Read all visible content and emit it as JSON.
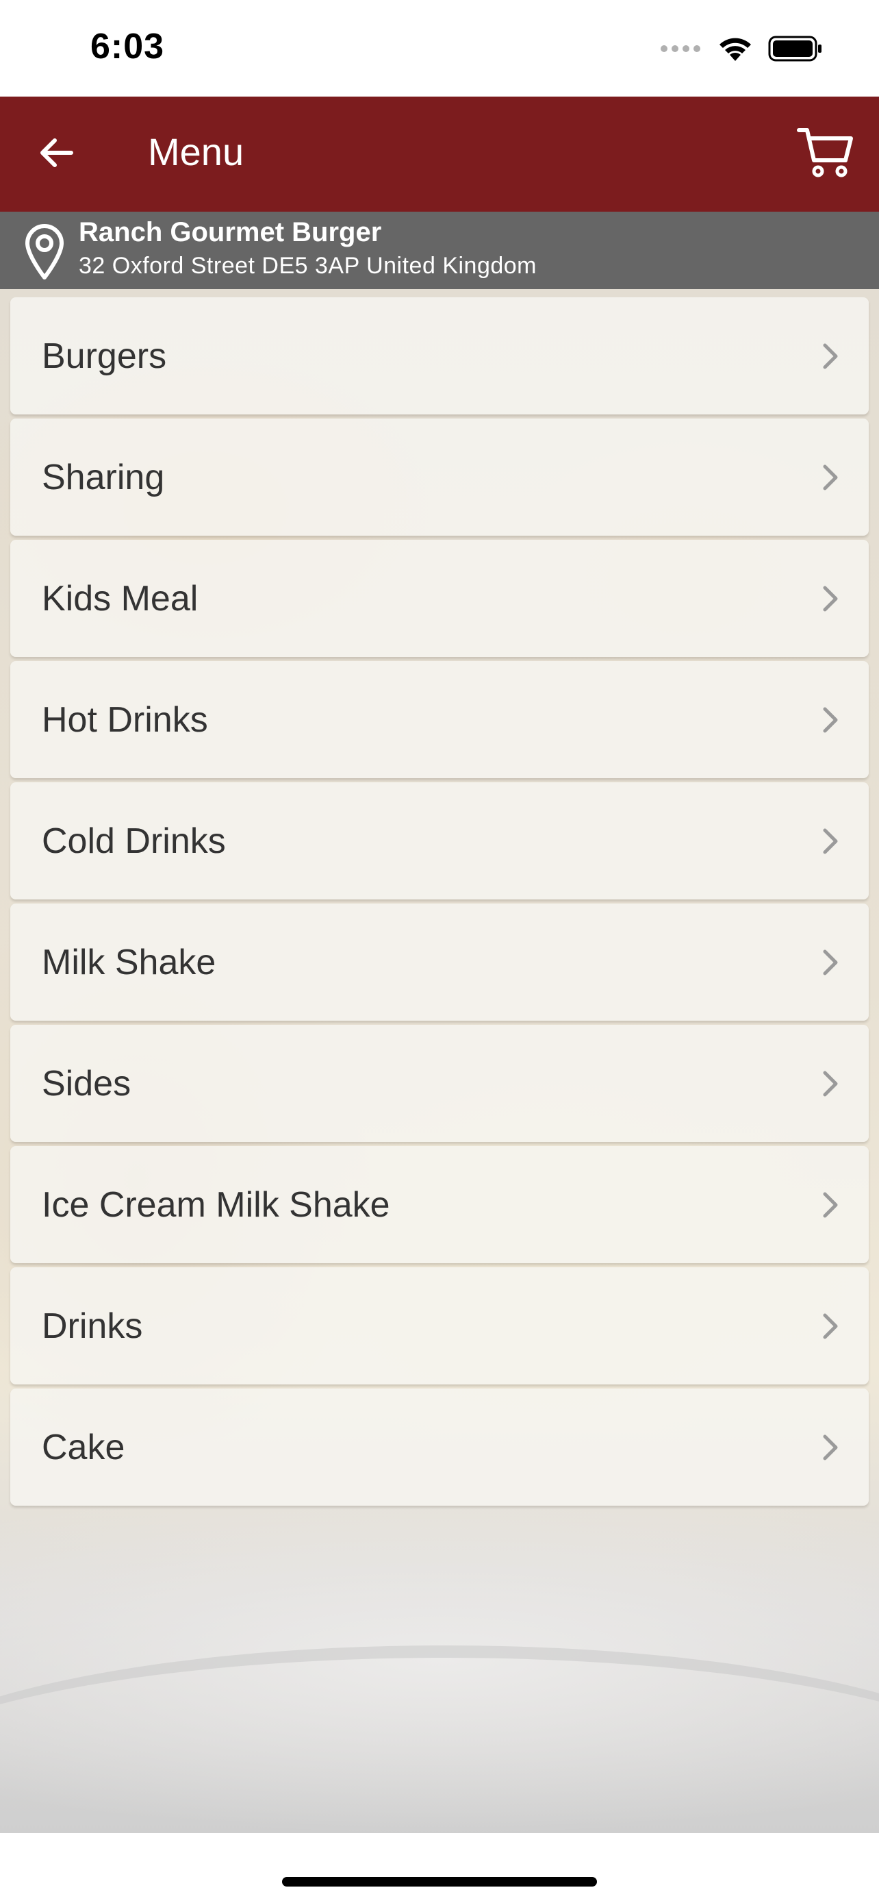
{
  "status_bar": {
    "time": "6:03",
    "icons": [
      "signal-icon",
      "wifi-icon",
      "battery-icon"
    ]
  },
  "nav": {
    "title": "Menu",
    "back_icon": "arrow-left-icon",
    "cart_icon": "cart-icon",
    "background_color": "#7c1c1e"
  },
  "location": {
    "icon": "map-pin-icon",
    "name": "Ranch Gourmet Burger",
    "address": "32 Oxford Street DE5 3AP United Kingdom",
    "background_color": "#666666"
  },
  "menu": {
    "items": [
      {
        "label": "Burgers"
      },
      {
        "label": "Sharing"
      },
      {
        "label": "Kids Meal"
      },
      {
        "label": "Hot Drinks"
      },
      {
        "label": "Cold Drinks"
      },
      {
        "label": "Milk Shake"
      },
      {
        "label": "Sides"
      },
      {
        "label": "Ice Cream Milk Shake"
      },
      {
        "label": "Drinks"
      },
      {
        "label": "Cake"
      }
    ],
    "chevron_icon": "chevron-right-icon"
  }
}
